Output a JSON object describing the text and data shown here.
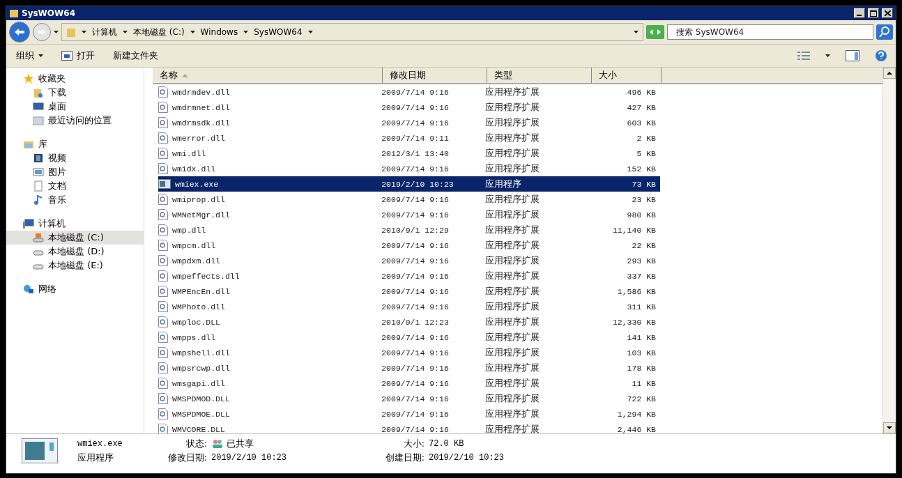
{
  "window": {
    "title": "SysWOW64"
  },
  "address": {
    "crumbs": [
      "计算机",
      "本地磁盘 (C:)",
      "Windows",
      "SysWOW64"
    ]
  },
  "search": {
    "placeholder": "搜索 SysWOW64"
  },
  "toolbar": {
    "items": [
      {
        "kind": "menu",
        "label": "组织"
      },
      {
        "kind": "open",
        "label": "打开"
      },
      {
        "kind": "plain",
        "label": "新建文件夹"
      }
    ]
  },
  "sidebar": {
    "groups": [
      {
        "label": "收藏夹",
        "kind": "star",
        "children": [
          {
            "label": "下载",
            "kind": "download",
            "selected": false
          },
          {
            "label": "桌面",
            "kind": "desktop",
            "selected": false
          },
          {
            "label": "最近访问的位置",
            "kind": "recent",
            "selected": false
          }
        ]
      },
      {
        "label": "库",
        "kind": "library",
        "children": [
          {
            "label": "视频",
            "kind": "video",
            "selected": false
          },
          {
            "label": "图片",
            "kind": "picture",
            "selected": false
          },
          {
            "label": "文档",
            "kind": "document",
            "selected": false
          },
          {
            "label": "音乐",
            "kind": "music",
            "selected": false
          }
        ]
      },
      {
        "label": "计算机",
        "kind": "computer",
        "children": [
          {
            "label": "本地磁盘 (C:)",
            "kind": "systemdrive",
            "selected": true
          },
          {
            "label": "本地磁盘 (D:)",
            "kind": "drive",
            "selected": false
          },
          {
            "label": "本地磁盘 (E:)",
            "kind": "drive",
            "selected": false
          }
        ]
      },
      {
        "label": "网络",
        "kind": "network"
      }
    ]
  },
  "table": {
    "columns": [
      {
        "label": "名称",
        "sorted": true
      },
      {
        "label": "修改日期",
        "sorted": false
      },
      {
        "label": "类型",
        "sorted": false
      },
      {
        "label": "大小",
        "sorted": false
      }
    ],
    "rows": [
      {
        "kind": "dll",
        "name": "wmdrmdev.dll",
        "date": "2009/7/14 9:16",
        "type": "应用程序扩展",
        "size": "496 KB",
        "selected": false
      },
      {
        "kind": "dll",
        "name": "wmdrmnet.dll",
        "date": "2009/7/14 9:16",
        "type": "应用程序扩展",
        "size": "427 KB",
        "selected": false
      },
      {
        "kind": "dll",
        "name": "wmdrmsdk.dll",
        "date": "2009/7/14 9:16",
        "type": "应用程序扩展",
        "size": "603 KB",
        "selected": false
      },
      {
        "kind": "dll",
        "name": "wmerror.dll",
        "date": "2009/7/14 9:11",
        "type": "应用程序扩展",
        "size": "2 KB",
        "selected": false
      },
      {
        "kind": "dll",
        "name": "wmi.dll",
        "date": "2012/3/1 13:40",
        "type": "应用程序扩展",
        "size": "5 KB",
        "selected": false
      },
      {
        "kind": "dll",
        "name": "wmidx.dll",
        "date": "2009/7/14 9:16",
        "type": "应用程序扩展",
        "size": "152 KB",
        "selected": false
      },
      {
        "kind": "exe",
        "name": "wmiex.exe",
        "date": "2019/2/10 10:23",
        "type": "应用程序",
        "size": "73 KB",
        "selected": true
      },
      {
        "kind": "dll",
        "name": "wmiprop.dll",
        "date": "2009/7/14 9:16",
        "type": "应用程序扩展",
        "size": "23 KB",
        "selected": false
      },
      {
        "kind": "dll",
        "name": "WMNetMgr.dll",
        "date": "2009/7/14 9:16",
        "type": "应用程序扩展",
        "size": "980 KB",
        "selected": false
      },
      {
        "kind": "dll",
        "name": "wmp.dll",
        "date": "2010/9/1 12:29",
        "type": "应用程序扩展",
        "size": "11,140 KB",
        "selected": false
      },
      {
        "kind": "dll",
        "name": "wmpcm.dll",
        "date": "2009/7/14 9:16",
        "type": "应用程序扩展",
        "size": "22 KB",
        "selected": false
      },
      {
        "kind": "dll",
        "name": "wmpdxm.dll",
        "date": "2009/7/14 9:16",
        "type": "应用程序扩展",
        "size": "293 KB",
        "selected": false
      },
      {
        "kind": "dll",
        "name": "wmpeffects.dll",
        "date": "2009/7/14 9:16",
        "type": "应用程序扩展",
        "size": "337 KB",
        "selected": false
      },
      {
        "kind": "dll",
        "name": "WMPEncEn.dll",
        "date": "2009/7/14 9:16",
        "type": "应用程序扩展",
        "size": "1,586 KB",
        "selected": false
      },
      {
        "kind": "dll",
        "name": "WMPhoto.dll",
        "date": "2009/7/14 9:16",
        "type": "应用程序扩展",
        "size": "311 KB",
        "selected": false
      },
      {
        "kind": "dll",
        "name": "wmploc.DLL",
        "date": "2010/9/1 12:23",
        "type": "应用程序扩展",
        "size": "12,330 KB",
        "selected": false
      },
      {
        "kind": "dll",
        "name": "wmpps.dll",
        "date": "2009/7/14 9:16",
        "type": "应用程序扩展",
        "size": "141 KB",
        "selected": false
      },
      {
        "kind": "dll",
        "name": "wmpshell.dll",
        "date": "2009/7/14 9:16",
        "type": "应用程序扩展",
        "size": "103 KB",
        "selected": false
      },
      {
        "kind": "dll",
        "name": "wmpsrcwp.dll",
        "date": "2009/7/14 9:16",
        "type": "应用程序扩展",
        "size": "178 KB",
        "selected": false
      },
      {
        "kind": "dll",
        "name": "wmsgapi.dll",
        "date": "2009/7/14 9:16",
        "type": "应用程序扩展",
        "size": "11 KB",
        "selected": false
      },
      {
        "kind": "dll",
        "name": "WMSPDMOD.DLL",
        "date": "2009/7/14 9:16",
        "type": "应用程序扩展",
        "size": "722 KB",
        "selected": false
      },
      {
        "kind": "dll",
        "name": "WMSPDMOE.DLL",
        "date": "2009/7/14 9:16",
        "type": "应用程序扩展",
        "size": "1,294 KB",
        "selected": false
      },
      {
        "kind": "dll",
        "name": "WMVCORE.DLL",
        "date": "2009/7/14 9:16",
        "type": "应用程序扩展",
        "size": "2,446 KB",
        "selected": false
      }
    ]
  },
  "details": {
    "name": "wmiex.exe",
    "type": "应用程序",
    "fields": [
      {
        "label": "状态:",
        "value": "已共享",
        "kind": "shared"
      },
      {
        "label": "大小:",
        "value": "72.0 KB"
      },
      {
        "label": "修改日期:",
        "value": "2019/2/10 10:23"
      },
      {
        "label": "创建日期:",
        "value": "2019/2/10 10:23"
      }
    ]
  }
}
